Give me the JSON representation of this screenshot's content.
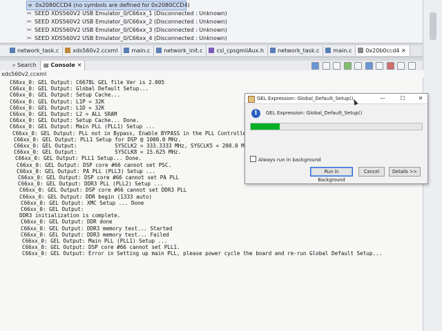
{
  "debug_tree": {
    "rows": [
      {
        "icon": "≡",
        "label": "0x2080CCD4  (no symbols are defined for 0x2080CCD4)",
        "selected": true
      },
      {
        "icon": "✂",
        "label": "SEED XDS560V2 USB Emulator_0/C66xx_1 (Disconnected : Unknown)",
        "selected": false
      },
      {
        "icon": "✂",
        "label": "SEED XDS560V2 USB Emulator_0/C66xx_2 (Disconnected : Unknown)",
        "selected": false
      },
      {
        "icon": "✂",
        "label": "SEED XDS560V2 USB Emulator_0/C66xx_3 (Disconnected : Unknown)",
        "selected": false
      },
      {
        "icon": "✂",
        "label": "SEED XDS560V2 USB Emulator_0/C66xx_4 (Disconnected : Unknown)",
        "selected": false
      }
    ]
  },
  "editor_tabs": [
    {
      "label": "network_task.c",
      "color": "#5a7fb5"
    },
    {
      "label": "xds560v2.ccxml",
      "color": "#c08a3a"
    },
    {
      "label": "main.c",
      "color": "#5a7fb5"
    },
    {
      "label": "network_init.c",
      "color": "#5a7fb5"
    },
    {
      "label": "csl_cpsgmiiAux.h",
      "color": "#7a5ab5"
    },
    {
      "label": "network_task.c",
      "color": "#5a7fb5"
    },
    {
      "label": "main.c",
      "color": "#5a7fb5"
    },
    {
      "label": "0x20b0ccd4 ✕",
      "color": "#888888"
    }
  ],
  "view_tabs": {
    "search": "Search",
    "console": "Console ✕"
  },
  "console_name": "xds560v2.ccxml",
  "console_lines": [
    "C66xx_0: GEL Output: C6678L GEL file Ver is 2.005",
    "C66xx_0: GEL Output: Global Default Setup...",
    "C66xx_0: GEL Output: Setup Cache...",
    "C66xx_0: GEL Output: L1P = 32K",
    "C66xx_0: GEL Output: L1D = 32K",
    "C66xx_0: GEL Output: L2 = ALL SRAM",
    "C66xx_0: GEL Output: Setup Cache... Done.",
    "C66xx_0: GEL Output: Main PLL (PLL1) Setup ...",
    "C66xx_0: GEL Output: PLL not in Bypass, Enable BYPASS in the PLL Controller...",
    "C66xx_0: GEL Output: PLL1 Setup for DSP @ 1000.0 MHz.",
    "C66xx_0: GEL Output:            SYSCLK2 = 333.3333 MHz, SYSCLK5 = 200.0 MHz.",
    "C66xx_0: GEL Output:            SYSCLK8 = 15.625 MHz.",
    "C66xx_0: GEL Output: PLL1 Setup... Done.",
    "C66xx_0: GEL Output: DSP core #66 cannot set PSC.",
    "C66xx_0: GEL Output: PA PLL (PLL3) Setup ...",
    "C66xx_0: GEL Output: DSP core #66 cannot set PA PLL",
    "C66xx_0: GEL Output: DDR3 PLL (PLL2) Setup ...",
    "C66xx_0: GEL Output: DSP core #66 cannot set DDR3 PLL",
    "C66xx_0: GEL Output: DDR begin (1333 auto)",
    "C66xx_0: GEL Output: XMC Setup ... Done",
    "C66xx_0: GEL Output:",
    "DDR3 initialization is complete.",
    "C66xx_0: GEL Output: DDR done",
    "C66xx_0: GEL Output: DDR3 memory test... Started",
    "C66xx_0: GEL Output: DDR3 memory test... Failed",
    "C66xx_0: GEL Output: Main PLL (PLL1) Setup ...",
    "C66xx_0: GEL Output: DSP core #66 cannot set PLL1.",
    "C66xx_0: GEL Output: Error in Setting up main PLL, please power cycle the board and re-run Global Default Setup..."
  ],
  "dialog": {
    "title": "GEL Expression: Global_Default_Setup()",
    "message": "GEL Expression: Global_Default_Setup()",
    "progress": 0.17,
    "checkbox_label": "Always run in background",
    "buttons": {
      "run_bg": "Run in Background",
      "cancel": "Cancel",
      "details": "Details >>"
    },
    "window_controls": {
      "minimize": "—",
      "maximize": "☐",
      "close": "✕"
    }
  },
  "colors": {
    "progress_fill": "#06b025",
    "selection": "#c9d7ee"
  }
}
